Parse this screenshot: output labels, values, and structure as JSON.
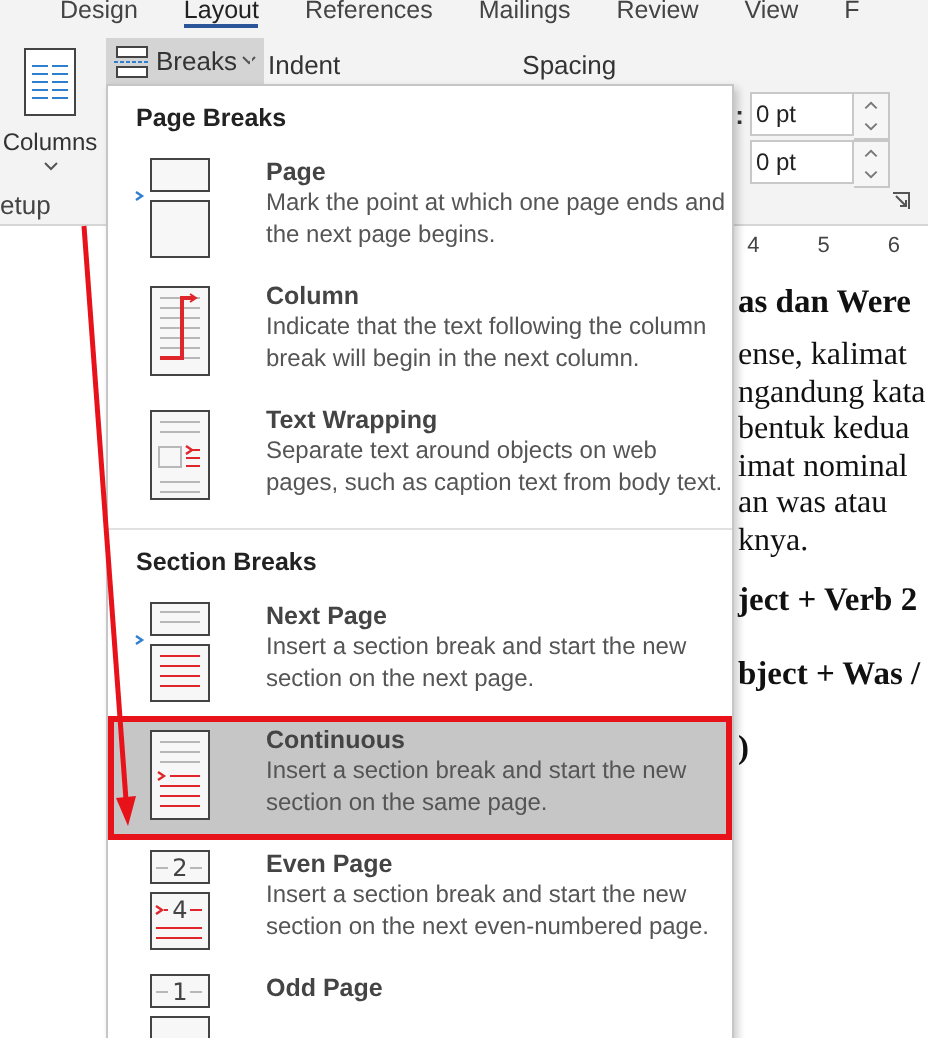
{
  "ribbon_tabs": [
    {
      "label": "Design",
      "selected": false
    },
    {
      "label": "Layout",
      "selected": true
    },
    {
      "label": "References",
      "selected": false
    },
    {
      "label": "Mailings",
      "selected": false
    },
    {
      "label": "Review",
      "selected": false
    },
    {
      "label": "View",
      "selected": false
    },
    {
      "label": "F",
      "selected": false
    }
  ],
  "ribbon": {
    "columns_label": "Columns",
    "group_label": "etup",
    "breaks_label": "Breaks",
    "indent_label": "Indent",
    "spacing_label": "Spacing",
    "colon": ":",
    "spacing_fields": [
      "0 pt",
      "0 pt"
    ]
  },
  "ruler": [
    "4",
    "5",
    "6"
  ],
  "document_lines": [
    {
      "kind": "heading",
      "text": "as dan Were"
    },
    {
      "kind": "body",
      "text": "ense, kalimat"
    },
    {
      "kind": "body",
      "text": "ngandung kata"
    },
    {
      "kind": "body",
      "text": "bentuk kedua"
    },
    {
      "kind": "body",
      "text": "imat nominal"
    },
    {
      "kind": "body",
      "text": "an was atau"
    },
    {
      "kind": "body",
      "text": "knya."
    },
    {
      "kind": "heading",
      "text": "ject + Verb 2"
    },
    {
      "kind": "heading",
      "text": "bject + Was /"
    },
    {
      "kind": "heading",
      "text": ")"
    }
  ],
  "breaks_menu": {
    "sections": [
      {
        "title": "Page Breaks",
        "items": [
          {
            "kind": "page",
            "title": "Page",
            "description": "Mark the point at which one page ends and the next page begins.",
            "selected": false
          },
          {
            "kind": "column",
            "title": "Column",
            "description": "Indicate that the text following the column break will begin in the next column.",
            "selected": false
          },
          {
            "kind": "text-wrapping",
            "title": "Text Wrapping",
            "description": "Separate text around objects on web pages, such as caption text from body text.",
            "selected": false
          }
        ]
      },
      {
        "title": "Section Breaks",
        "items": [
          {
            "kind": "next-page",
            "title": "Next Page",
            "description": "Insert a section break and start the new section on the next page.",
            "selected": false
          },
          {
            "kind": "continuous",
            "title": "Continuous",
            "description": "Insert a section break and start the new section on the same page.",
            "selected": true
          },
          {
            "kind": "even-page",
            "title": "Even Page",
            "description": "Insert a section break and start the new section on the next even-numbered page.",
            "selected": false,
            "page_numbers": [
              "2",
              "4"
            ]
          },
          {
            "kind": "odd-page",
            "title": "Odd Page",
            "selected": false,
            "page_numbers": [
              "1"
            ]
          }
        ]
      }
    ]
  }
}
